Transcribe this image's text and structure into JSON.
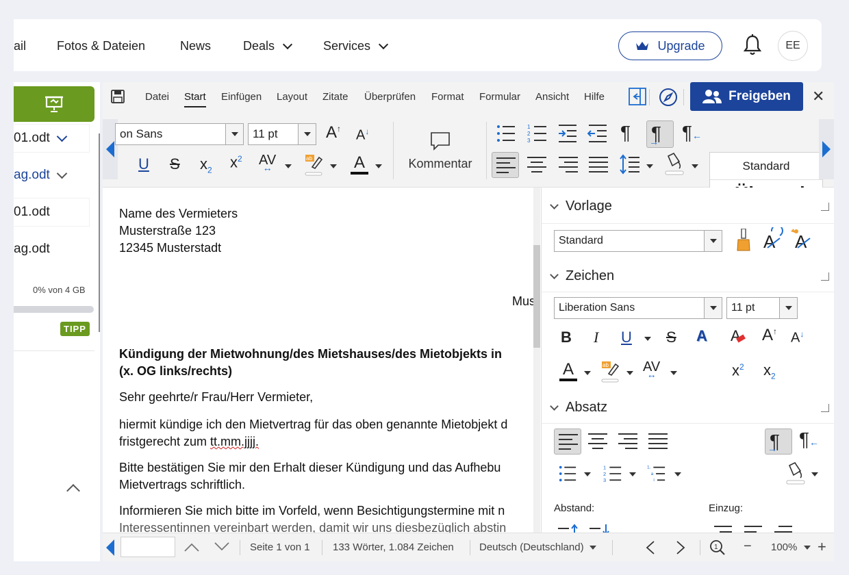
{
  "topnav": {
    "items": [
      "ail",
      "Fotos & Dateien",
      "News",
      "Deals",
      "Services"
    ],
    "upgrade_label": "Upgrade",
    "avatar_initials": "EE"
  },
  "sidebar": {
    "files": [
      "01.odt",
      "ag.odt",
      "01.odt",
      "ag.odt"
    ],
    "quota_text": "0% von 4 GB",
    "quota_percent": 0,
    "tipp_label": "TIPP"
  },
  "menu": {
    "items": [
      "Datei",
      "Start",
      "Einfügen",
      "Layout",
      "Zitate",
      "Überprüfen",
      "Format",
      "Formular",
      "Ansicht",
      "Hilfe"
    ],
    "active": "Start",
    "share_label": "Freigeben",
    "close_label": "✕"
  },
  "ribbon": {
    "font_name": "on Sans",
    "font_size": "11 pt",
    "comment_label": "Kommentar",
    "styles": [
      "Standard",
      "Überschr"
    ]
  },
  "document": {
    "lines": [
      "Name des Vermieters",
      "Musterstraße 123",
      "12345 Musterstadt",
      "Must",
      "Kündigung der Mietwohnung/des Mietshauses/des Mietobjekts in",
      "(x. OG links/rechts)",
      "Sehr geehrte/r Frau/Herr Vermieter,",
      "hiermit kündige ich den Mietvertrag für das oben genannte Mietobjekt d",
      "fristgerecht zum ",
      "tt.mm.jjjj.",
      "Bitte bestätigen Sie mir den Erhalt dieser Kündigung und das Aufhebu",
      "Mietvertrags schriftlich.",
      "Informieren Sie mich bitte im Vorfeld, wenn Besichtigungstermine mit n",
      "Interessentinnen vereinbart werden, damit wir uns diesbezüglich abstin"
    ]
  },
  "panel": {
    "vorlage_title": "Vorlage",
    "vorlage_style": "Standard",
    "zeichen_title": "Zeichen",
    "font_name": "Liberation Sans",
    "font_size": "11 pt",
    "absatz_title": "Absatz",
    "abstand_label": "Abstand:",
    "einzug_label": "Einzug:"
  },
  "status": {
    "page_text": "Seite 1 von 1",
    "word_count": "133 Wörter, 1.084 Zeichen",
    "language": "Deutsch (Deutschland)",
    "zoom": "100%"
  },
  "colors": {
    "brand_blue": "#1c449b",
    "green": "#6a9a1f",
    "arrow_blue": "#1c6dd0"
  }
}
